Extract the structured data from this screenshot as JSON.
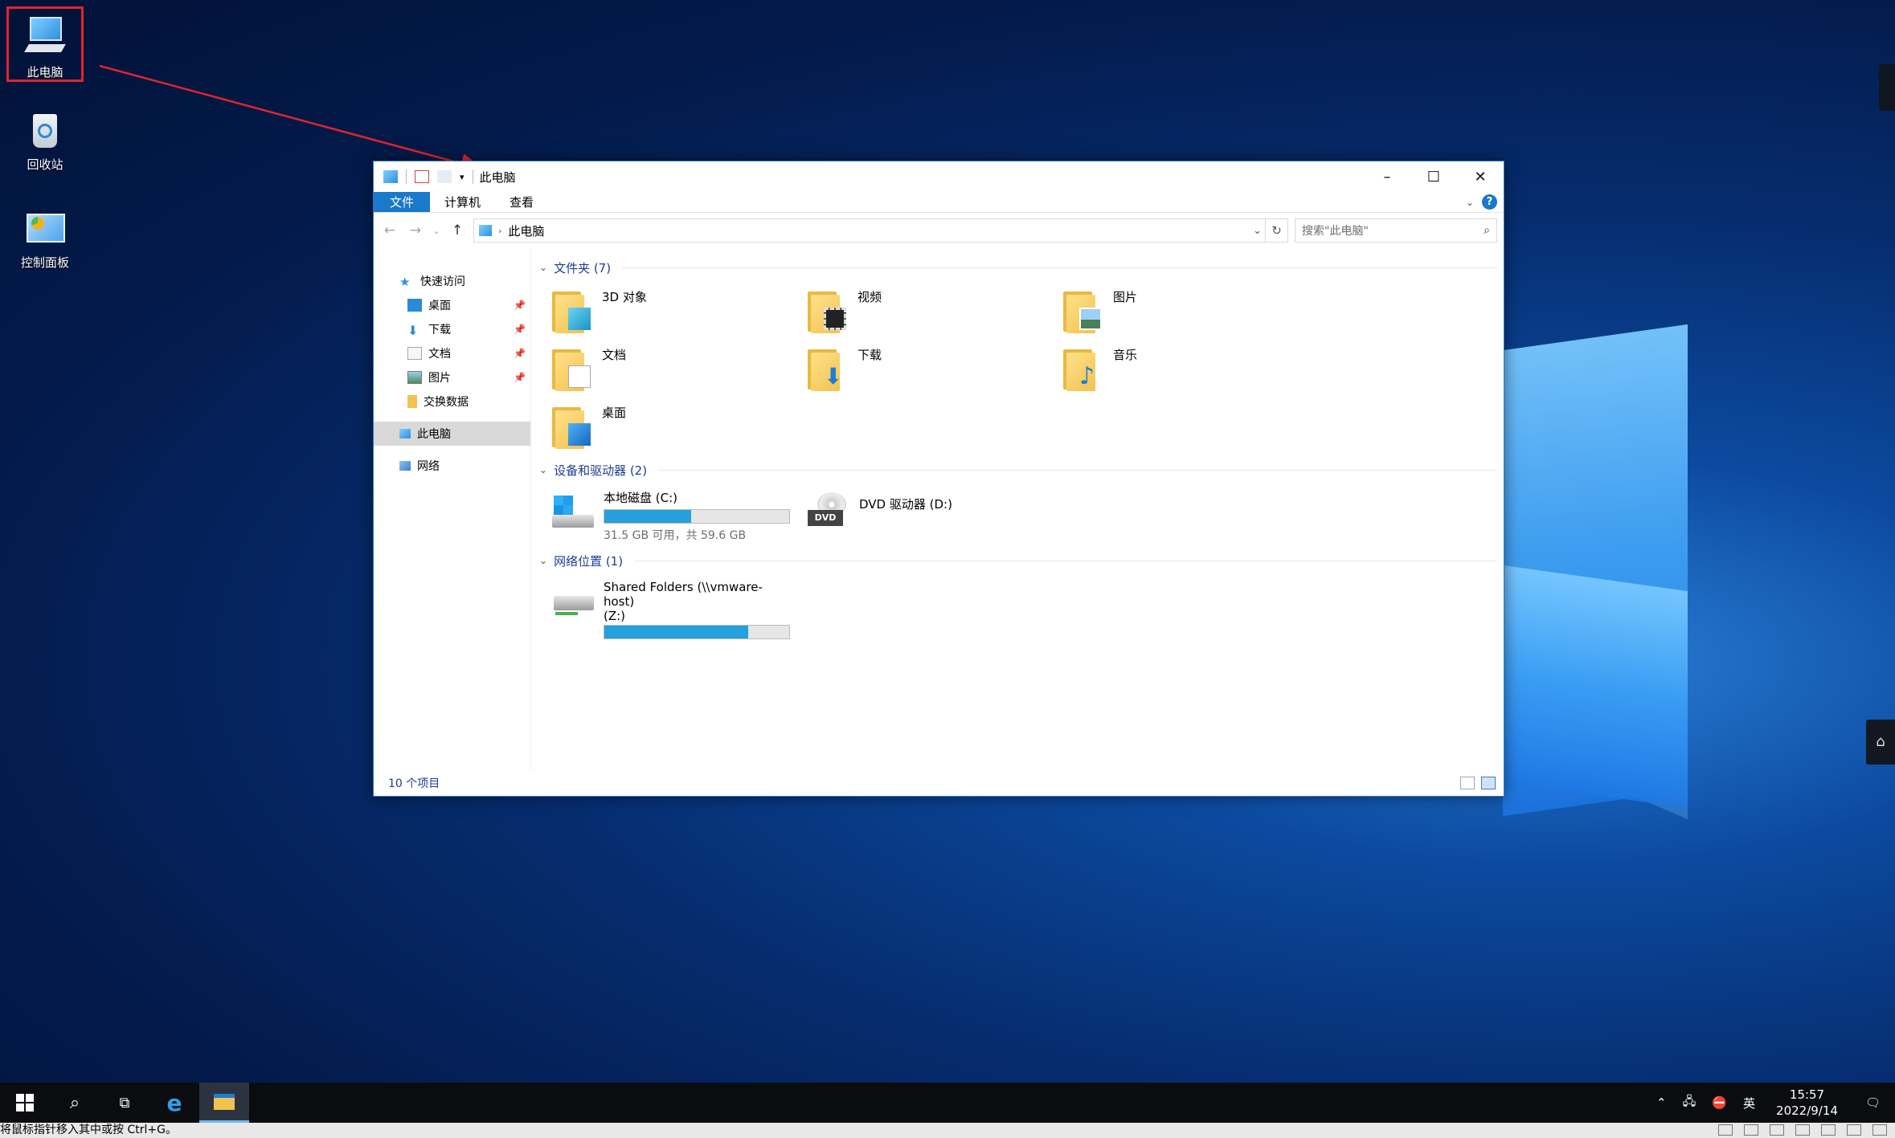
{
  "desktop": {
    "icons": [
      {
        "label": "此电脑"
      },
      {
        "label": "回收站"
      },
      {
        "label": "控制面板"
      }
    ]
  },
  "window": {
    "title": "此电脑",
    "ribbon_tabs": [
      "文件",
      "计算机",
      "查看"
    ],
    "address": "此电脑",
    "search_placeholder": "搜索\"此电脑\"",
    "nav": {
      "quick_access": "快速访问",
      "items": [
        {
          "label": "桌面",
          "pinned": true
        },
        {
          "label": "下载",
          "pinned": true
        },
        {
          "label": "文档",
          "pinned": true
        },
        {
          "label": "图片",
          "pinned": true
        },
        {
          "label": "交换数据",
          "pinned": false
        }
      ],
      "this_pc": "此电脑",
      "network": "网络"
    },
    "groups": {
      "folders_header": "文件夹 (7)",
      "folders": [
        "3D 对象",
        "视频",
        "图片",
        "文档",
        "下载",
        "音乐",
        "桌面"
      ],
      "devices_header": "设备和驱动器 (2)",
      "drives": [
        {
          "name": "本地磁盘 (C:)",
          "detail": "31.5 GB 可用，共 59.6 GB",
          "used_fraction": 0.47
        },
        {
          "name": "DVD 驱动器 (D:)"
        }
      ],
      "network_header": "网络位置 (1)",
      "network_locations": [
        {
          "name_line1": "Shared Folders (\\\\vmware-host)",
          "name_line2": "(Z:)",
          "used_fraction": 0.78
        }
      ]
    },
    "status": "10 个项目"
  },
  "taskbar": {
    "clock_time": "15:57",
    "clock_date": "2022/9/14",
    "ime": "英"
  },
  "hint_bar": "将鼠标指针移入其中或按 Ctrl+G。"
}
